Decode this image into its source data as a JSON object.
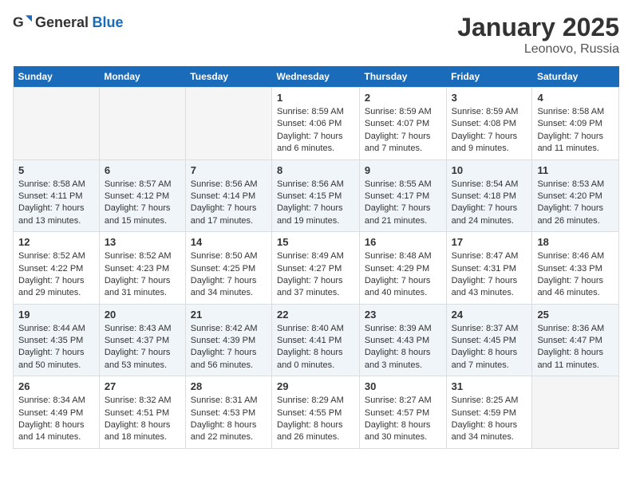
{
  "logo": {
    "general": "General",
    "blue": "Blue"
  },
  "title": "January 2025",
  "subtitle": "Leonovo, Russia",
  "days": [
    "Sunday",
    "Monday",
    "Tuesday",
    "Wednesday",
    "Thursday",
    "Friday",
    "Saturday"
  ],
  "weeks": [
    [
      {
        "num": "",
        "text": ""
      },
      {
        "num": "",
        "text": ""
      },
      {
        "num": "",
        "text": ""
      },
      {
        "num": "1",
        "text": "Sunrise: 8:59 AM\nSunset: 4:06 PM\nDaylight: 7 hours\nand 6 minutes."
      },
      {
        "num": "2",
        "text": "Sunrise: 8:59 AM\nSunset: 4:07 PM\nDaylight: 7 hours\nand 7 minutes."
      },
      {
        "num": "3",
        "text": "Sunrise: 8:59 AM\nSunset: 4:08 PM\nDaylight: 7 hours\nand 9 minutes."
      },
      {
        "num": "4",
        "text": "Sunrise: 8:58 AM\nSunset: 4:09 PM\nDaylight: 7 hours\nand 11 minutes."
      }
    ],
    [
      {
        "num": "5",
        "text": "Sunrise: 8:58 AM\nSunset: 4:11 PM\nDaylight: 7 hours\nand 13 minutes."
      },
      {
        "num": "6",
        "text": "Sunrise: 8:57 AM\nSunset: 4:12 PM\nDaylight: 7 hours\nand 15 minutes."
      },
      {
        "num": "7",
        "text": "Sunrise: 8:56 AM\nSunset: 4:14 PM\nDaylight: 7 hours\nand 17 minutes."
      },
      {
        "num": "8",
        "text": "Sunrise: 8:56 AM\nSunset: 4:15 PM\nDaylight: 7 hours\nand 19 minutes."
      },
      {
        "num": "9",
        "text": "Sunrise: 8:55 AM\nSunset: 4:17 PM\nDaylight: 7 hours\nand 21 minutes."
      },
      {
        "num": "10",
        "text": "Sunrise: 8:54 AM\nSunset: 4:18 PM\nDaylight: 7 hours\nand 24 minutes."
      },
      {
        "num": "11",
        "text": "Sunrise: 8:53 AM\nSunset: 4:20 PM\nDaylight: 7 hours\nand 26 minutes."
      }
    ],
    [
      {
        "num": "12",
        "text": "Sunrise: 8:52 AM\nSunset: 4:22 PM\nDaylight: 7 hours\nand 29 minutes."
      },
      {
        "num": "13",
        "text": "Sunrise: 8:52 AM\nSunset: 4:23 PM\nDaylight: 7 hours\nand 31 minutes."
      },
      {
        "num": "14",
        "text": "Sunrise: 8:50 AM\nSunset: 4:25 PM\nDaylight: 7 hours\nand 34 minutes."
      },
      {
        "num": "15",
        "text": "Sunrise: 8:49 AM\nSunset: 4:27 PM\nDaylight: 7 hours\nand 37 minutes."
      },
      {
        "num": "16",
        "text": "Sunrise: 8:48 AM\nSunset: 4:29 PM\nDaylight: 7 hours\nand 40 minutes."
      },
      {
        "num": "17",
        "text": "Sunrise: 8:47 AM\nSunset: 4:31 PM\nDaylight: 7 hours\nand 43 minutes."
      },
      {
        "num": "18",
        "text": "Sunrise: 8:46 AM\nSunset: 4:33 PM\nDaylight: 7 hours\nand 46 minutes."
      }
    ],
    [
      {
        "num": "19",
        "text": "Sunrise: 8:44 AM\nSunset: 4:35 PM\nDaylight: 7 hours\nand 50 minutes."
      },
      {
        "num": "20",
        "text": "Sunrise: 8:43 AM\nSunset: 4:37 PM\nDaylight: 7 hours\nand 53 minutes."
      },
      {
        "num": "21",
        "text": "Sunrise: 8:42 AM\nSunset: 4:39 PM\nDaylight: 7 hours\nand 56 minutes."
      },
      {
        "num": "22",
        "text": "Sunrise: 8:40 AM\nSunset: 4:41 PM\nDaylight: 8 hours\nand 0 minutes."
      },
      {
        "num": "23",
        "text": "Sunrise: 8:39 AM\nSunset: 4:43 PM\nDaylight: 8 hours\nand 3 minutes."
      },
      {
        "num": "24",
        "text": "Sunrise: 8:37 AM\nSunset: 4:45 PM\nDaylight: 8 hours\nand 7 minutes."
      },
      {
        "num": "25",
        "text": "Sunrise: 8:36 AM\nSunset: 4:47 PM\nDaylight: 8 hours\nand 11 minutes."
      }
    ],
    [
      {
        "num": "26",
        "text": "Sunrise: 8:34 AM\nSunset: 4:49 PM\nDaylight: 8 hours\nand 14 minutes."
      },
      {
        "num": "27",
        "text": "Sunrise: 8:32 AM\nSunset: 4:51 PM\nDaylight: 8 hours\nand 18 minutes."
      },
      {
        "num": "28",
        "text": "Sunrise: 8:31 AM\nSunset: 4:53 PM\nDaylight: 8 hours\nand 22 minutes."
      },
      {
        "num": "29",
        "text": "Sunrise: 8:29 AM\nSunset: 4:55 PM\nDaylight: 8 hours\nand 26 minutes."
      },
      {
        "num": "30",
        "text": "Sunrise: 8:27 AM\nSunset: 4:57 PM\nDaylight: 8 hours\nand 30 minutes."
      },
      {
        "num": "31",
        "text": "Sunrise: 8:25 AM\nSunset: 4:59 PM\nDaylight: 8 hours\nand 34 minutes."
      },
      {
        "num": "",
        "text": ""
      }
    ]
  ]
}
